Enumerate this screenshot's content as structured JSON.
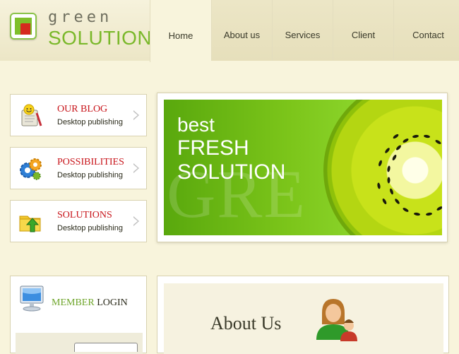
{
  "logo": {
    "line1": "green",
    "line2": "SOLUTIONS"
  },
  "nav": [
    {
      "label": "Home",
      "active": true
    },
    {
      "label": "About us",
      "active": false
    },
    {
      "label": "Services",
      "active": false
    },
    {
      "label": "Client",
      "active": false
    },
    {
      "label": "Contact",
      "active": false
    }
  ],
  "sidebar": {
    "items": [
      {
        "title": "OUR BLOG",
        "subtitle": "Desktop publishing",
        "icon": "blog-smiley-icon"
      },
      {
        "title": "POSSIBILITIES",
        "subtitle": "Desktop publishing",
        "icon": "gears-icon"
      },
      {
        "title": "SOLUTIONS",
        "subtitle": "Desktop publishing",
        "icon": "folder-arrow-icon"
      }
    ]
  },
  "banner": {
    "line1": "best",
    "line2": "FRESH",
    "line3": "SOLUTION",
    "background_word": "GRE"
  },
  "login": {
    "title_a": "MEMBER",
    "title_b": "LOGIN",
    "icon": "computer-icon"
  },
  "about": {
    "title": "About Us",
    "icon": "family-people-icon"
  },
  "colors": {
    "brand_green": "#7ab82a",
    "accent_red": "#c8151b",
    "page_bg": "#f8f4dc"
  }
}
